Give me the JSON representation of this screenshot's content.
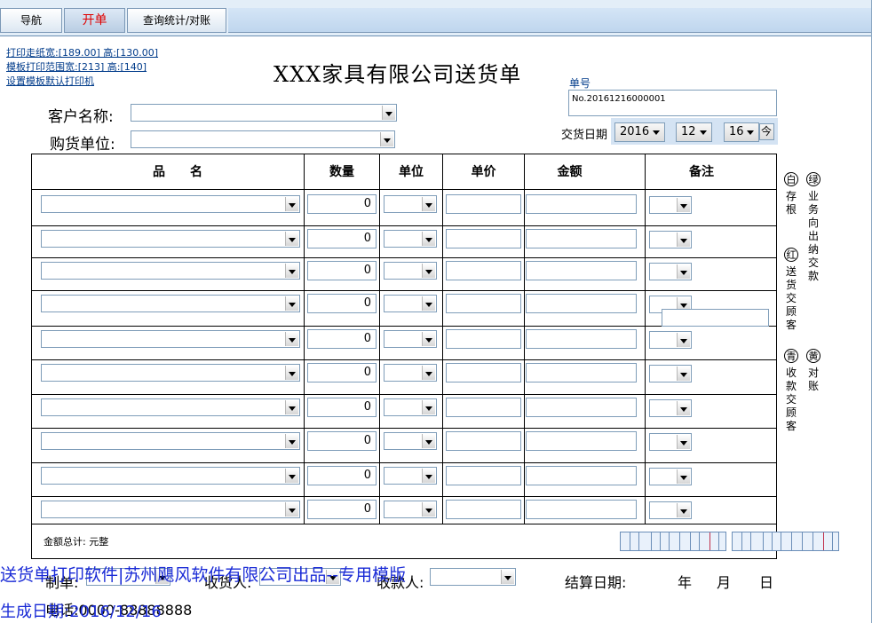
{
  "tabs": [
    {
      "label": "导航"
    },
    {
      "label": "开单"
    },
    {
      "label": "查询统计/对账"
    }
  ],
  "links": {
    "print_paper": "打印走纸宽:[189.00] 高:[130.00]",
    "template_range": "模板打印范围宽:[213] 高:[140]",
    "default_printer": "设置模板默认打印机"
  },
  "form": {
    "title": "XXX家具有限公司送货单",
    "order_no_label": "单号",
    "order_no": "No.20161216000001",
    "customer_label": "客户名称:",
    "purchase_unit_label": "购货单位:",
    "delivery_date_label": "交货日期",
    "year": "2016",
    "month": "12",
    "day": "16",
    "today_btn": "今"
  },
  "table": {
    "headers": [
      "品　　名",
      "数量",
      "单位",
      "单价",
      "金额",
      "备注"
    ],
    "rows": [
      {
        "qty": "0"
      },
      {
        "qty": "0"
      },
      {
        "qty": "0"
      },
      {
        "qty": "0"
      },
      {
        "qty": "0"
      },
      {
        "qty": "0"
      },
      {
        "qty": "0"
      },
      {
        "qty": "0"
      },
      {
        "qty": "0"
      },
      {
        "qty": "0"
      }
    ],
    "total_label": "金额总计: 元整"
  },
  "side": {
    "c1": "白",
    "c1_text": "存根",
    "c2": "绿",
    "c2_text": "业务向出纳交款",
    "c3": "红",
    "c3_text": "送货交顾客",
    "c4": "青",
    "c4_text": "收款交顾客",
    "c5": "黄",
    "c5_text": "对账"
  },
  "footer": {
    "maker_label": "制单:",
    "receiver_label": "收货人:",
    "cashier_label": "收款人:",
    "settle_label": "结算日期:",
    "year_label": "年",
    "month_label": "月",
    "day_label": "日",
    "phone": "电话:0000-88888888",
    "watermark1": "送货单打印软件|苏州飓风软件有限公司出品--专用模版",
    "watermark2": "生成日期:2016/12/16"
  }
}
